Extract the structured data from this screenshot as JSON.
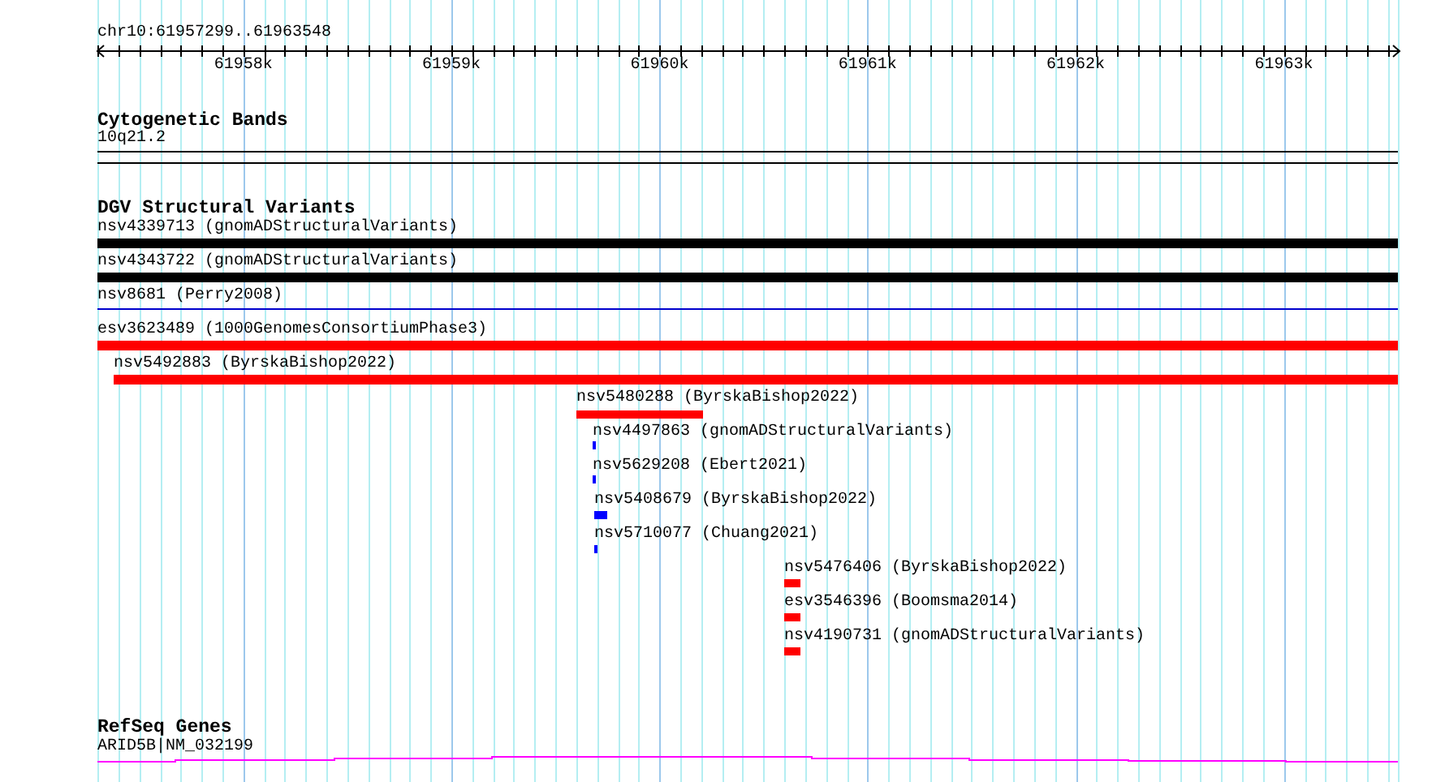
{
  "ruler": {
    "location": "chr10:61957299..61963548",
    "ticks": [
      "61958k",
      "61959k",
      "61960k",
      "61961k",
      "61962k",
      "61963k"
    ]
  },
  "tracks": [
    {
      "kind": "bands",
      "title": "Cytogenetic Bands",
      "features": [
        {
          "label": "10q21.2"
        }
      ]
    },
    {
      "kind": "variants",
      "title": "DGV Structural Variants",
      "features": [
        {
          "label": "nsv4339713 (gnomADStructuralVariants)",
          "color": "#000000"
        },
        {
          "label": "nsv4343722 (gnomADStructuralVariants)",
          "color": "#000000"
        },
        {
          "label": "nsv8681 (Perry2008)",
          "color": "#0000cc"
        },
        {
          "label": "esv3623489 (1000GenomesConsortiumPhase3)",
          "color": "#ff0000"
        },
        {
          "label": "nsv5492883 (ByrskaBishop2022)",
          "color": "#ff0000"
        },
        {
          "label": "nsv5480288 (ByrskaBishop2022)",
          "color": "#ff0000"
        },
        {
          "label": "nsv4497863 (gnomADStructuralVariants)",
          "color": "#0000ff"
        },
        {
          "label": "nsv5629208 (Ebert2021)",
          "color": "#0000ff"
        },
        {
          "label": "nsv5408679 (ByrskaBishop2022)",
          "color": "#0000ff"
        },
        {
          "label": "nsv5710077 (Chuang2021)",
          "color": "#0000ff"
        },
        {
          "label": "nsv5476406 (ByrskaBishop2022)",
          "color": "#ff0000"
        },
        {
          "label": "esv3546396 (Boomsma2014)",
          "color": "#ff0000"
        },
        {
          "label": "nsv4190731 (gnomADStructuralVariants)",
          "color": "#ff0000"
        }
      ]
    },
    {
      "kind": "genes",
      "title": "RefSeq Genes",
      "features": [
        {
          "label": "ARID5B|NM_032199"
        }
      ]
    }
  ]
}
